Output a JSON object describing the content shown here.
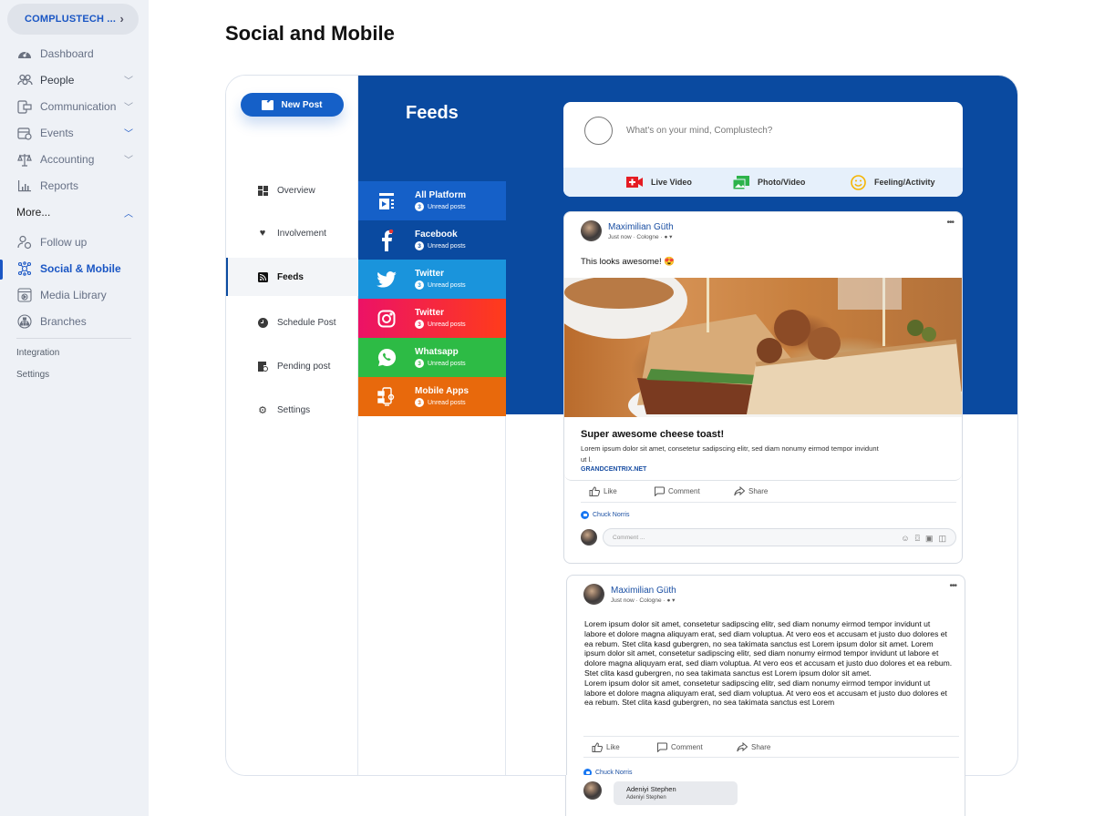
{
  "sidebar": {
    "org_name": "COMPLUSTECH ...",
    "items": [
      {
        "label": "Dashboard",
        "icon": "dashboard-icon"
      },
      {
        "label": "People",
        "icon": "people-icon",
        "has_dropdown": true
      },
      {
        "label": "Communication",
        "icon": "communication-icon",
        "has_dropdown": true
      },
      {
        "label": "Events",
        "icon": "events-icon",
        "has_dropdown": true
      },
      {
        "label": "Accounting",
        "icon": "accounting-icon",
        "has_dropdown": true
      },
      {
        "label": "Reports",
        "icon": "reports-icon"
      }
    ],
    "more_label": "More...",
    "more_items": [
      {
        "label": "Follow up",
        "icon": "follow-up-icon"
      },
      {
        "label": "Social & Mobile",
        "icon": "social-mobile-icon",
        "active": true
      },
      {
        "label": "Media Library",
        "icon": "media-library-icon"
      },
      {
        "label": "Branches",
        "icon": "branches-icon"
      }
    ],
    "footer_links": [
      "Integration",
      "Settings"
    ]
  },
  "page": {
    "title": "Social and Mobile"
  },
  "left_panel": {
    "new_post_label": "New Post",
    "items": [
      {
        "label": "Overview",
        "icon": "overview-icon"
      },
      {
        "label": "Involvement",
        "icon": "heart-icon"
      },
      {
        "label": "Feeds",
        "icon": "rss-icon",
        "active": true
      },
      {
        "label": "Schedule Post",
        "icon": "clock-icon"
      },
      {
        "label": "Pending post",
        "icon": "pending-icon"
      },
      {
        "label": "Settings",
        "icon": "gear-icon"
      }
    ]
  },
  "feeds": {
    "title": "Feeds",
    "platforms": [
      {
        "name": "All Platform",
        "unread_count": "3",
        "unread_label": "Unread posts",
        "icon": "all-platform-icon",
        "color": "#1560c8"
      },
      {
        "name": "Facebook",
        "unread_count": "3",
        "unread_label": "Unread posts",
        "icon": "facebook-icon",
        "color": "#0a4aa0"
      },
      {
        "name": "Twitter",
        "unread_count": "3",
        "unread_label": "Unread posts",
        "icon": "twitter-icon",
        "color": "#1a94dc"
      },
      {
        "name": "Twitter",
        "unread_count": "3",
        "unread_label": "Unread posts",
        "icon": "instagram-icon",
        "color": "#f0184e"
      },
      {
        "name": "Whatsapp",
        "unread_count": "3",
        "unread_label": "Unread posts",
        "icon": "whatsapp-icon",
        "color": "#2dbb45"
      },
      {
        "name": "Mobile Apps",
        "unread_count": "3",
        "unread_label": "Unread posts",
        "icon": "mobile-apps-icon",
        "color": "#e8690c"
      }
    ]
  },
  "composer": {
    "placeholder": "What's on your mind, Complustech?",
    "actions": [
      {
        "label": "Live Video",
        "icon": "live-video-icon"
      },
      {
        "label": "Photo/Video",
        "icon": "photo-video-icon"
      },
      {
        "label": "Feeling/Activity",
        "icon": "feeling-icon"
      }
    ]
  },
  "posts": [
    {
      "author": "Maximilian Güth",
      "meta": "Just now · Cologne ·",
      "text": "This looks awesome! 😍",
      "link": {
        "title": "Super awesome cheese toast!",
        "description": "Lorem ipsum dolor sit amet, consetetur sadipscing elitr, sed diam nonumy eirmod tempor invidunt ut l.",
        "domain": "GRANDCENTRIX.NET"
      },
      "actions": [
        "Like",
        "Comment",
        "Share"
      ],
      "liked_by": "Chuck Norris",
      "comment_placeholder": "Comment ..."
    },
    {
      "author": "Maximilian Güth",
      "meta": "Just now · Cologne ·",
      "text": "Lorem ipsum dolor sit amet, consetetur sadipscing elitr, sed diam nonumy eirmod tempor invidunt ut labore et dolore magna aliquyam erat, sed diam voluptua. At vero eos et accusam et justo duo dolores et ea rebum. Stet clita kasd gubergren, no sea takimata sanctus est Lorem ipsum dolor sit amet. Lorem ipsum dolor sit amet, consetetur sadipscing elitr, sed diam nonumy eirmod tempor invidunt ut labore et dolore magna aliquyam erat, sed diam voluptua. At vero eos et accusam et justo duo dolores et ea rebum. Stet clita kasd gubergren, no sea takimata sanctus est Lorem ipsum dolor sit amet.",
      "text2": "Lorem ipsum dolor sit amet, consetetur sadipscing elitr, sed diam nonumy eirmod tempor invidunt ut labore et dolore magna aliquyam erat, sed diam voluptua. At vero eos et accusam et justo duo dolores et ea rebum. Stet clita kasd gubergren, no sea takimata sanctus est Lorem",
      "actions": [
        "Like",
        "Comment",
        "Share"
      ],
      "liked_by": "Chuck Norris",
      "reply": {
        "name": "Adeniyi Stephen",
        "text": "Adeniyi Stephen"
      }
    }
  ]
}
